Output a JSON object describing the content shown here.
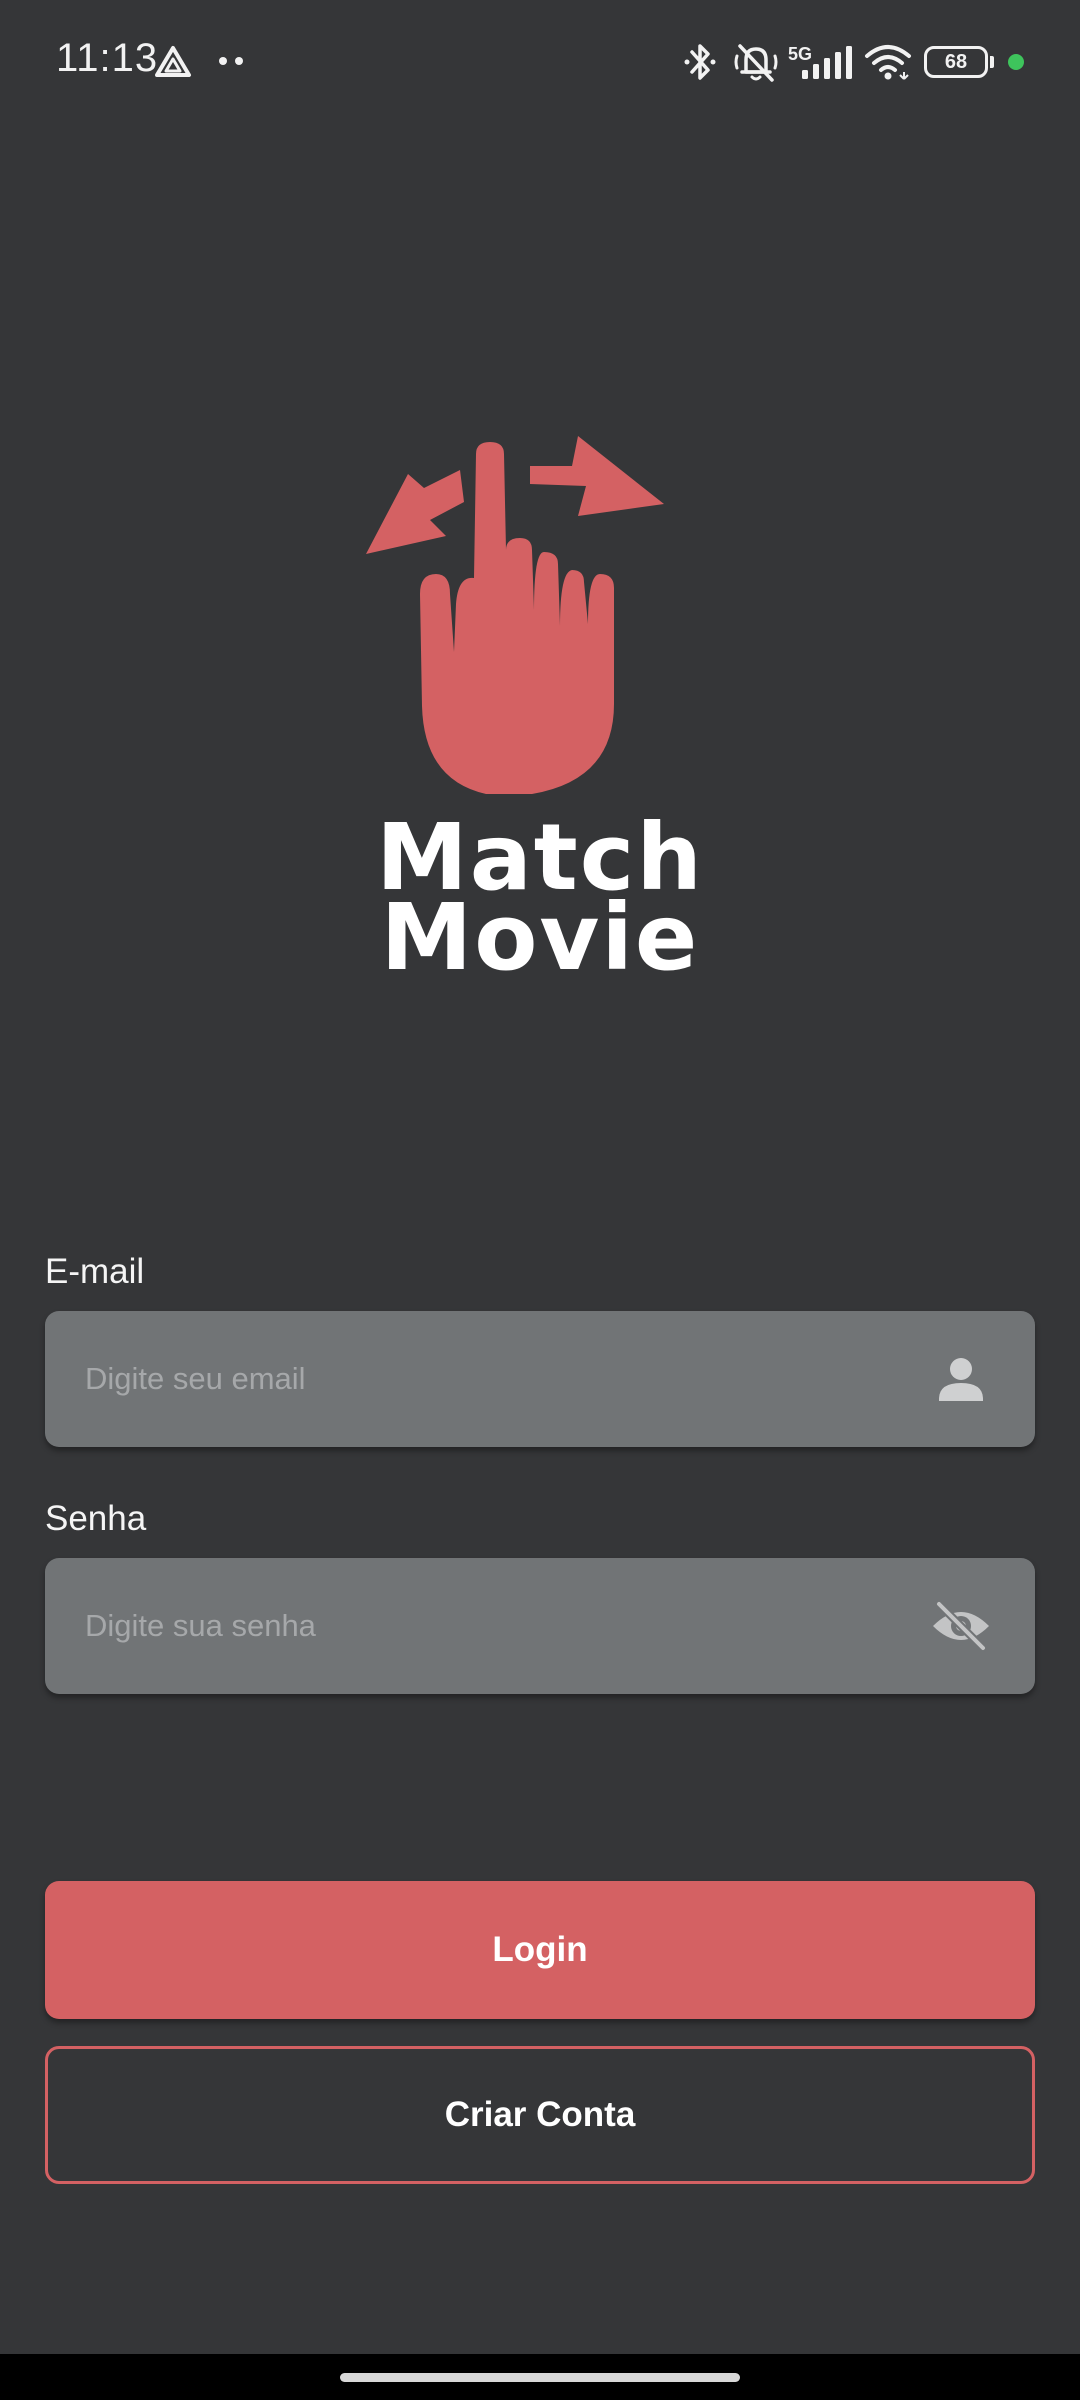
{
  "status_bar": {
    "time": "11:13",
    "network_label": "5G",
    "battery_level": "68",
    "icons": [
      "drive-icon",
      "more-dots-icon",
      "bluetooth-icon",
      "mute-icon",
      "signal-icon",
      "wifi-icon",
      "battery-icon",
      "charging-dot-icon"
    ]
  },
  "app": {
    "brand_line1": "Match",
    "brand_line2": "Movie",
    "logo_icon": "swipe-hand-icon",
    "accent_color": "#d46163",
    "background_color": "#353638"
  },
  "form": {
    "email_label": "E-mail",
    "email_value": "",
    "email_placeholder": "Digite seu email",
    "email_icon": "person-icon",
    "password_label": "Senha",
    "password_value": "",
    "password_placeholder": "Digite sua senha",
    "password_icon": "eye-off-icon"
  },
  "actions": {
    "login_label": "Login",
    "create_account_label": "Criar Conta"
  }
}
